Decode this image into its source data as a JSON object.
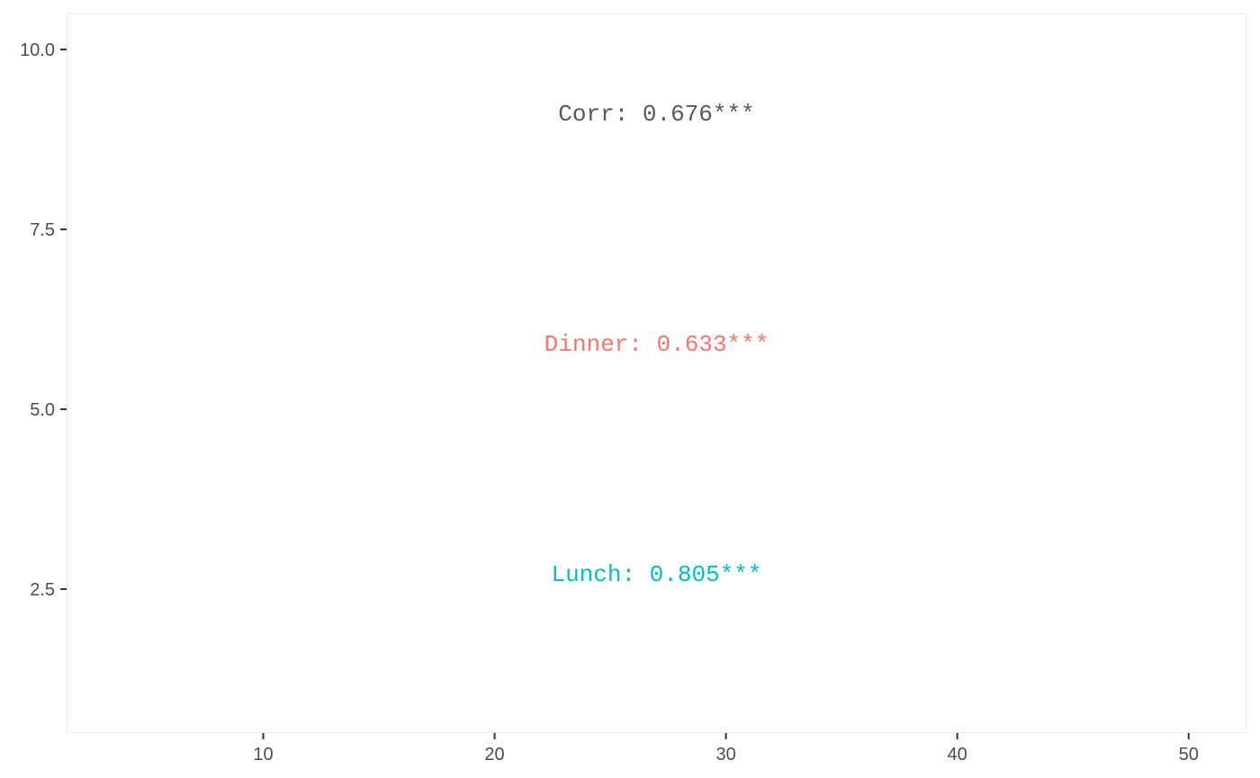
{
  "chart_data": {
    "type": "scatter",
    "title": "",
    "xlabel": "",
    "ylabel": "",
    "xlim": [
      1.5,
      52.5
    ],
    "ylim": [
      0.5,
      10.5
    ],
    "x_ticks": [
      10,
      20,
      30,
      40,
      50
    ],
    "y_ticks": [
      2.5,
      5.0,
      7.5,
      10.0
    ],
    "x_tick_labels": [
      "10",
      "20",
      "30",
      "40",
      "50"
    ],
    "y_tick_labels": [
      "2.5",
      "5.0",
      "7.5",
      "10.0"
    ],
    "grid": false,
    "panel_border_color": "#ebebeb",
    "annotations": [
      {
        "text": "Corr: 0.676***",
        "x": 27,
        "y": 9.1,
        "color": "#595959"
      },
      {
        "text": "Dinner: 0.633***",
        "x": 27,
        "y": 5.9,
        "color": "#f8766d"
      },
      {
        "text": "Lunch: 0.805***",
        "x": 27,
        "y": 2.7,
        "color": "#00bfc4"
      }
    ]
  }
}
